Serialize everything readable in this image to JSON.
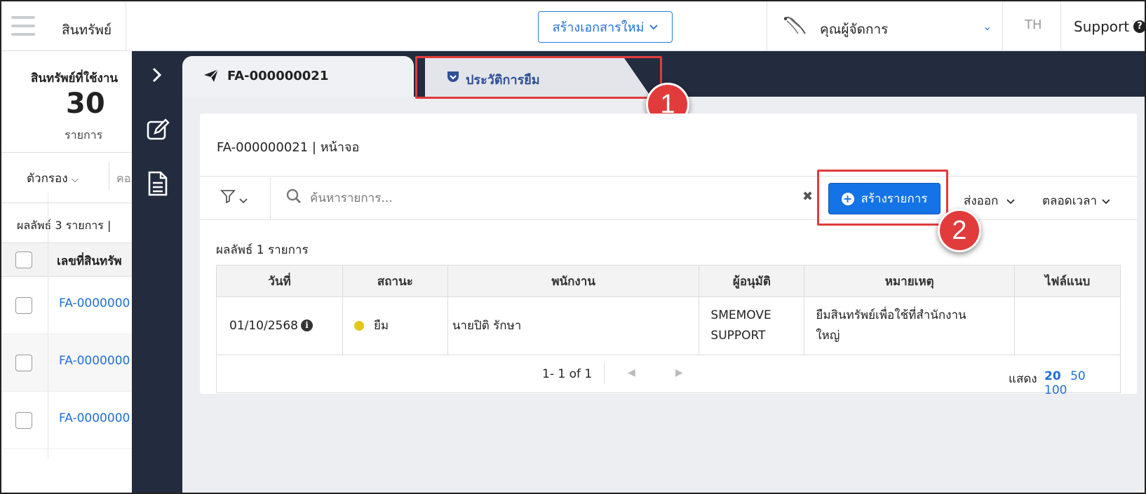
{
  "topbar": {
    "app_title": "สินทรัพย์",
    "new_doc_label": "สร้างเอกสารใหม่",
    "user_name": "คุณผู้จัดการ",
    "language": "TH",
    "support_label": "Support"
  },
  "left_panel": {
    "summary_title": "สินทรัพย์ที่ใช้งาน",
    "summary_count": "30",
    "summary_unit": "รายการ",
    "filter_label": "ตัวกรอง",
    "column_label": "คอ",
    "results_label": "ผลลัพธ์ 3 รายการ   |",
    "column_header": "เลขที่สินทรัพ",
    "rows": [
      "FA-0000000",
      "FA-0000000",
      "FA-0000000"
    ]
  },
  "tabs": [
    {
      "label": "FA-000000021",
      "icon": "send-icon"
    },
    {
      "label": "ประวัติการยืม",
      "icon": "pocket-shield-icon"
    }
  ],
  "annotations": {
    "badge_1": "1",
    "badge_2": "2",
    "highlight_color": "#e23b3b"
  },
  "card": {
    "title": "FA-000000021 | หน้าจอ",
    "search_placeholder": "ค้นหารายการ...",
    "create_label": "สร้างรายการ",
    "export_label": "ส่งออก",
    "period_label": "ตลอดเวลา",
    "results_label": "ผลลัพธ์ 1 รายการ"
  },
  "table": {
    "headers": [
      "วันที่",
      "สถานะ",
      "พนักงาน",
      "ผู้อนุมัติ",
      "หมายเหตุ",
      "ไฟล์แนบ"
    ],
    "rows": [
      {
        "date": "01/10/2568",
        "status": "ยืม",
        "status_color": "#e6c619",
        "employee": "นายปิติ รักษา",
        "approver_line1": "SMEMOVE",
        "approver_line2": "SUPPORT",
        "note_line1": "ยืมสินทรัพย์เพื่อใช้ที่สำนักงาน",
        "note_line2": "ใหญ่",
        "attachment": ""
      }
    ]
  },
  "pagination": {
    "range_text": "1- 1 of 1",
    "show_label": "แสดง",
    "page_sizes": [
      "20",
      "50",
      "100"
    ],
    "selected_page_size": "20"
  },
  "colors": {
    "accent": "#1473e6",
    "sidebar": "#232b3e",
    "content_bg": "#edeef1"
  }
}
